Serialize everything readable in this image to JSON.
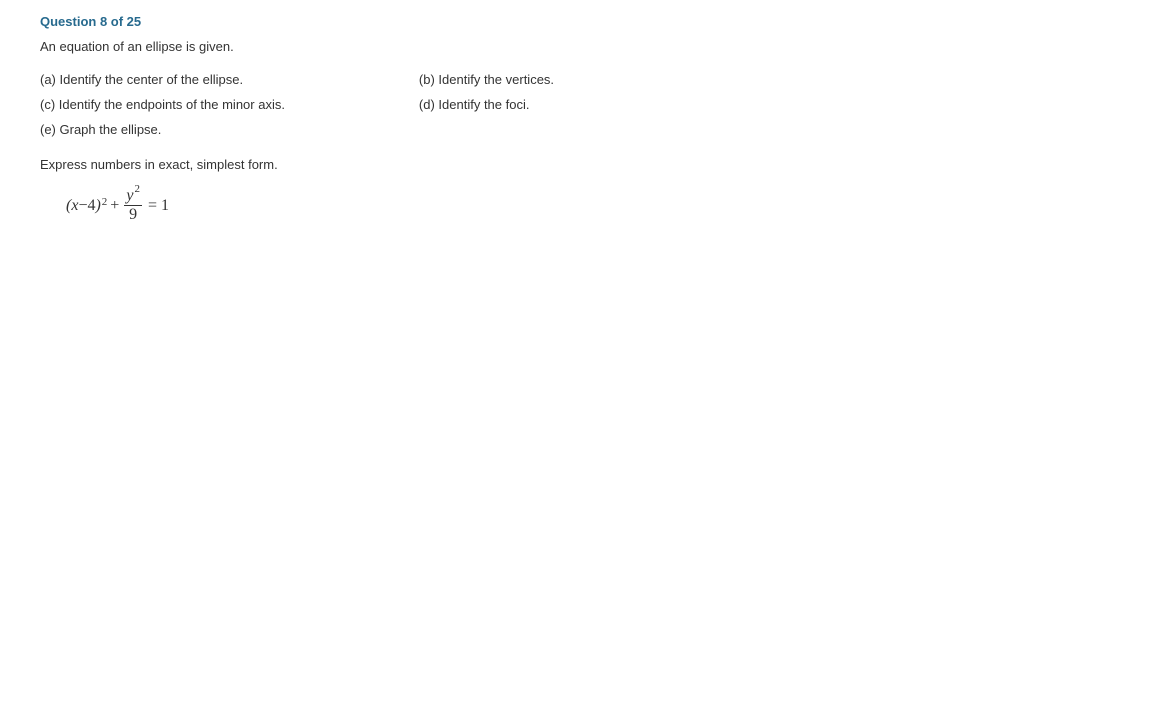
{
  "header": "Question 8 of 25",
  "intro": "An equation of an ellipse is given.",
  "parts": {
    "a": "(a) Identify the center of the ellipse.",
    "b": "(b) Identify the vertices.",
    "c": "(c) Identify the endpoints of the minor axis.",
    "d": "(d) Identify the foci.",
    "e": "(e) Graph the ellipse."
  },
  "instruction": "Express numbers in exact, simplest form.",
  "equation": {
    "lparen": "(",
    "x": "x",
    "minus": "−",
    "h": "4",
    "rparen": ")",
    "sq1": "2",
    "plus": "+",
    "y": "y",
    "sq2": "2",
    "denom": "9",
    "eq": "=",
    "rhs": "1"
  }
}
